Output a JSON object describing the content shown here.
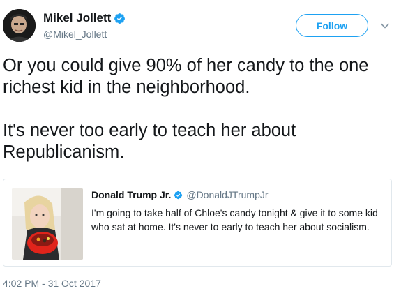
{
  "author": {
    "display_name": "Mikel Jollett",
    "handle": "@Mikel_Jollett",
    "verified": true,
    "avatar_icon": "avatar-photo"
  },
  "follow_button": {
    "label": "Follow"
  },
  "menu": {
    "icon": "chevron-down-icon"
  },
  "tweet": {
    "text": "Or you could give 90% of her candy to the one richest kid in the neighborhood.\n\nIt's never too early to teach her about Republicanism."
  },
  "quoted_tweet": {
    "display_name": "Donald Trump Jr.",
    "handle": "@DonaldJTrumpJr",
    "verified": true,
    "text": "I'm going to take half of Chloe's candy tonight & give it to some kid who sat at home. It's never to early to teach her about socialism.",
    "media_icon": "child-with-candy-bowl-photo"
  },
  "timestamp": "4:02 PM - 31 Oct 2017",
  "colors": {
    "accent": "#1da1f2",
    "text": "#14171a",
    "secondary_text": "#657786",
    "border": "#e1e8ed"
  }
}
